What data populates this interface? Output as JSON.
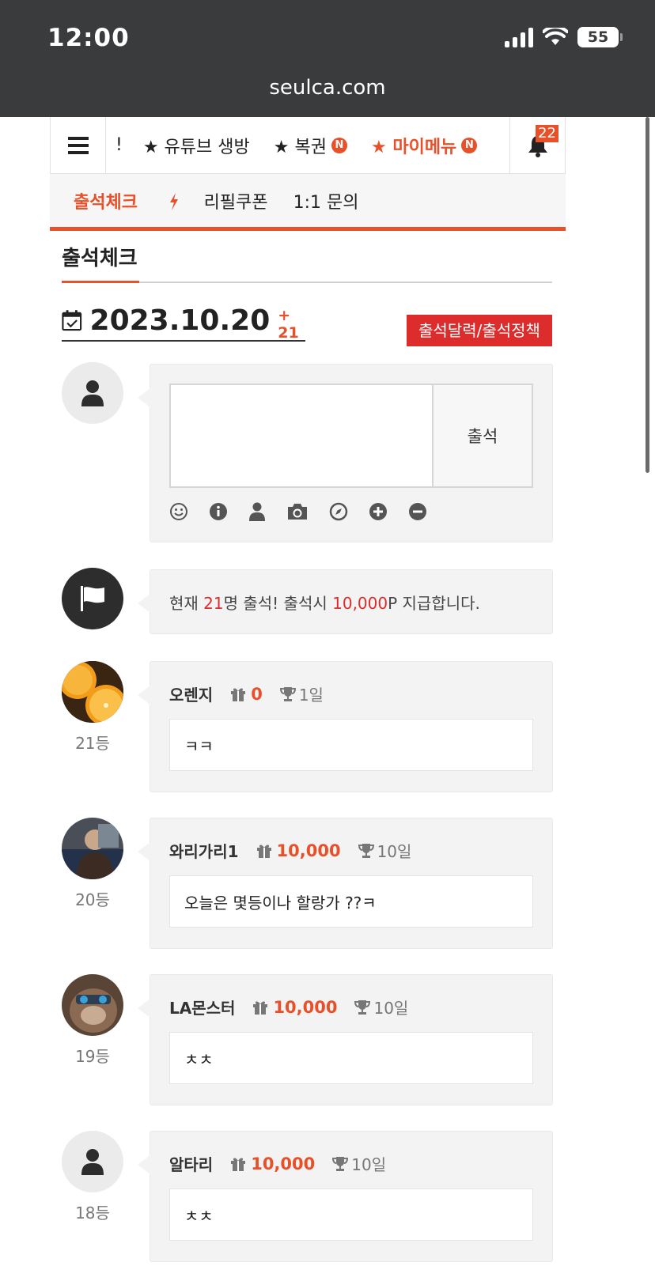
{
  "status_bar": {
    "time": "12:00",
    "battery": "55"
  },
  "browser": {
    "url": "seulca.com"
  },
  "top_nav": {
    "items": [
      {
        "label": "!"
      },
      {
        "label": "★ 유튜브 생방"
      },
      {
        "label": "★ 복권",
        "badge": "N"
      },
      {
        "label": "★ 마이메뉴",
        "badge": "N"
      }
    ],
    "notification_count": "22"
  },
  "sub_nav": {
    "items": [
      "출석체크",
      "리필쿠폰",
      "1:1 문의"
    ]
  },
  "section": {
    "title": "출석체크"
  },
  "date": {
    "value": "2023.10.20",
    "plus": "+ 21"
  },
  "policy_button": "출석달력/출석정책",
  "compose": {
    "submit_label": "출석"
  },
  "info": {
    "prefix": "현재 ",
    "count": "21",
    "middle": "명 출석! 출석시 ",
    "points": "10,000",
    "suffix": "P 지급합니다."
  },
  "entries": [
    {
      "rank": "21등",
      "name": "오렌지",
      "points": "0",
      "days": "1일",
      "message": "ㅋㅋ"
    },
    {
      "rank": "20등",
      "name": "와리가리1",
      "points": "10,000",
      "days": "10일",
      "message": "오늘은 몇등이나 할랑가 ??ㅋ"
    },
    {
      "rank": "19등",
      "name": "LA몬스터",
      "points": "10,000",
      "days": "10일",
      "message": "ㅊㅊ"
    },
    {
      "rank": "18등",
      "name": "알타리",
      "points": "10,000",
      "days": "10일",
      "message": "ㅊㅊ"
    }
  ],
  "colors": {
    "accent": "#e8502a",
    "policy_red": "#dd2c2c",
    "status_bg": "#3a3b3d"
  }
}
